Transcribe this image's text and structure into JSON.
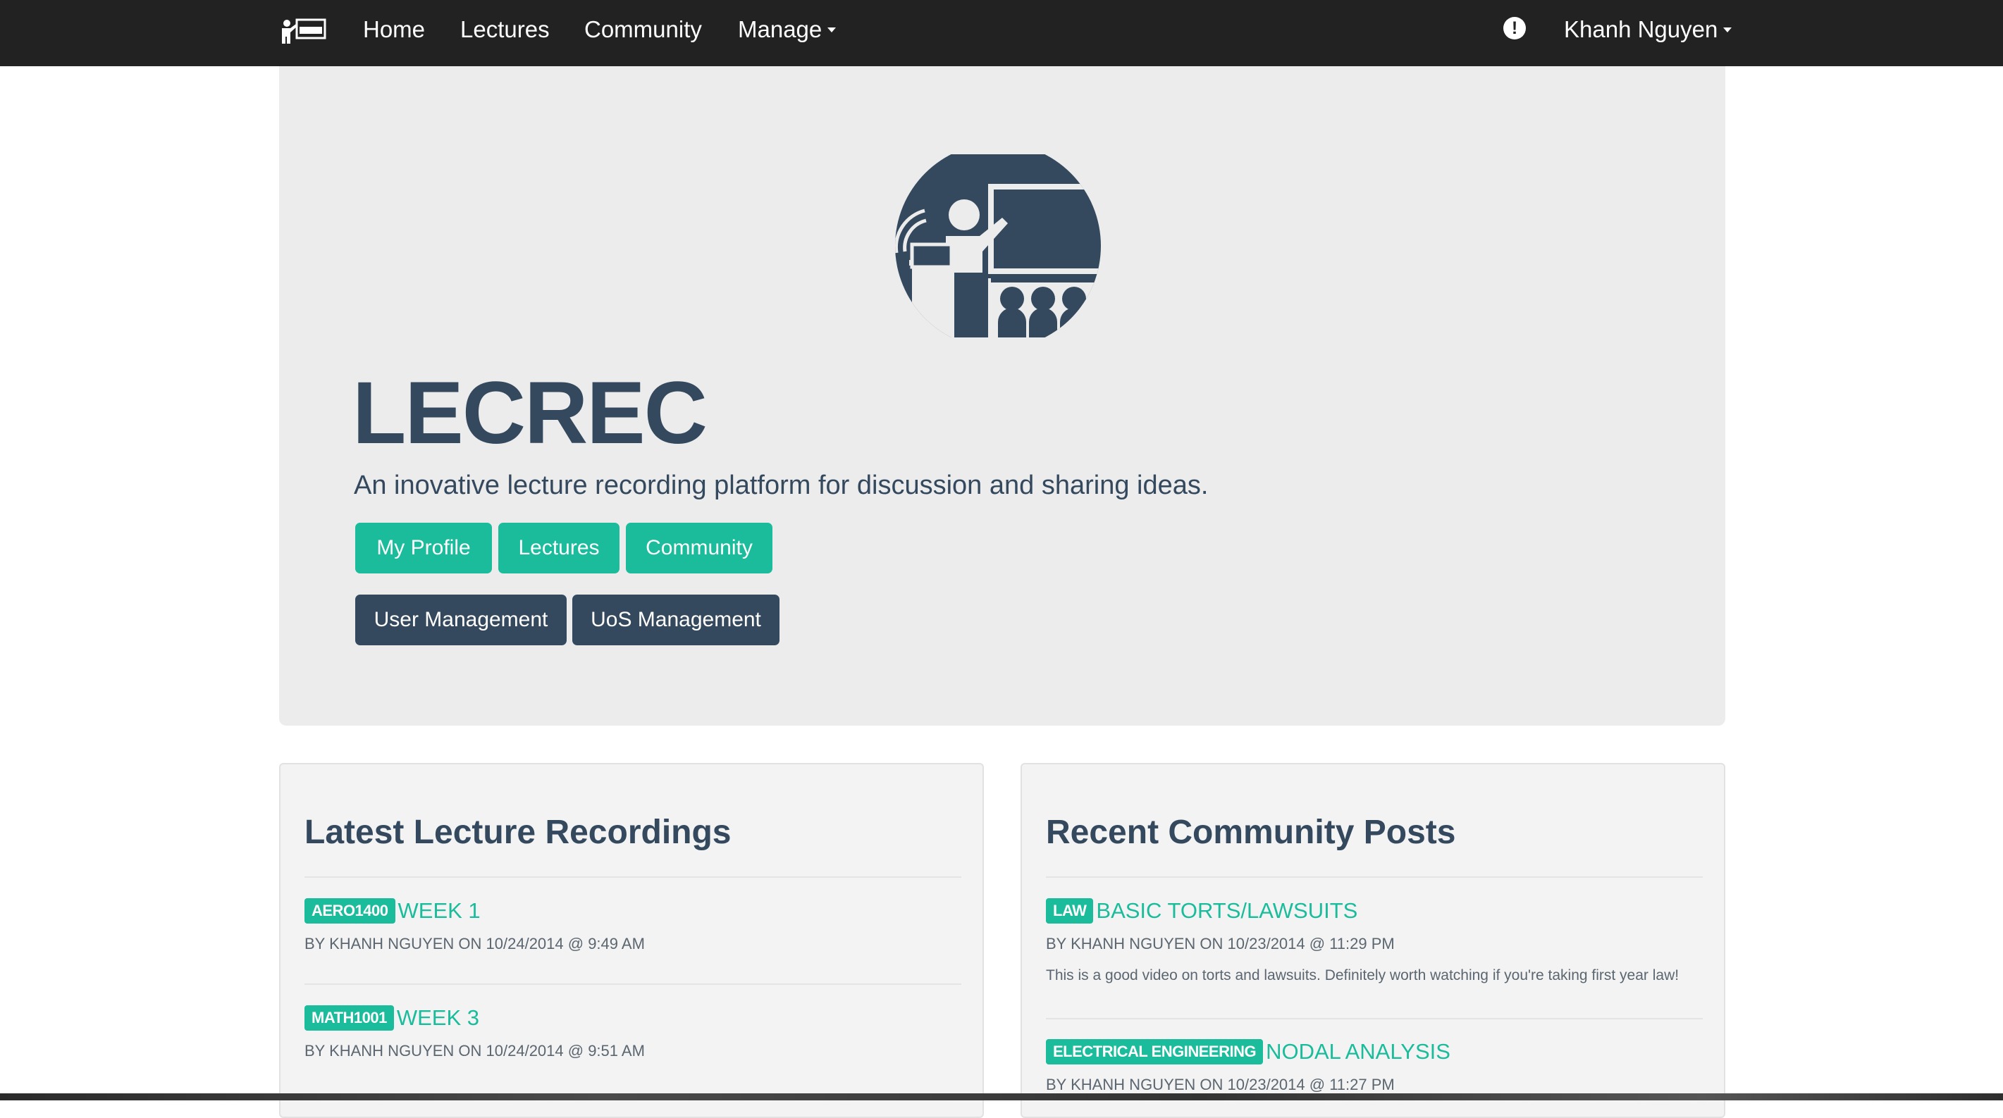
{
  "navbar": {
    "brand_icon": "lecturer-logo-icon",
    "links": {
      "home": "Home",
      "lectures": "Lectures",
      "community": "Community",
      "manage": "Manage"
    },
    "alert_icon_glyph": "!",
    "user": "Khanh Nguyen"
  },
  "hero": {
    "logo_icon": "lecturer-presentation-icon",
    "title": "LECREC",
    "tagline": "An inovative lecture recording platform for discussion and sharing ideas.",
    "buttons": {
      "profile": "My Profile",
      "lectures": "Lectures",
      "community": "Community",
      "user_management": "User Management",
      "uos_management": "UoS Management"
    }
  },
  "lectures_panel": {
    "title": "Latest Lecture Recordings",
    "items": [
      {
        "tag": "AERO1400",
        "title": "WEEK 1",
        "meta": "BY KHANH NGUYEN ON 10/24/2014 @ 9:49 AM"
      },
      {
        "tag": "MATH1001",
        "title": "WEEK 3",
        "meta": "BY KHANH NGUYEN ON 10/24/2014 @ 9:51 AM"
      }
    ]
  },
  "community_panel": {
    "title": "Recent Community Posts",
    "items": [
      {
        "tag": "LAW",
        "title": "BASIC TORTS/LAWSUITS",
        "meta": "BY KHANH NGUYEN ON 10/23/2014 @ 11:29 PM",
        "description": "This is a good video on torts and lawsuits. Definitely worth watching if you're taking first year law!"
      },
      {
        "tag": "ELECTRICAL ENGINEERING",
        "title": "NODAL ANALYSIS",
        "meta": "BY KHANH NGUYEN ON 10/23/2014 @ 11:27 PM"
      }
    ]
  },
  "colors": {
    "navbar_bg": "#222222",
    "primary_navy": "#34495e",
    "accent_teal": "#1abc9c",
    "jumbotron_bg": "#ececec",
    "panel_bg": "#f3f3f3"
  }
}
